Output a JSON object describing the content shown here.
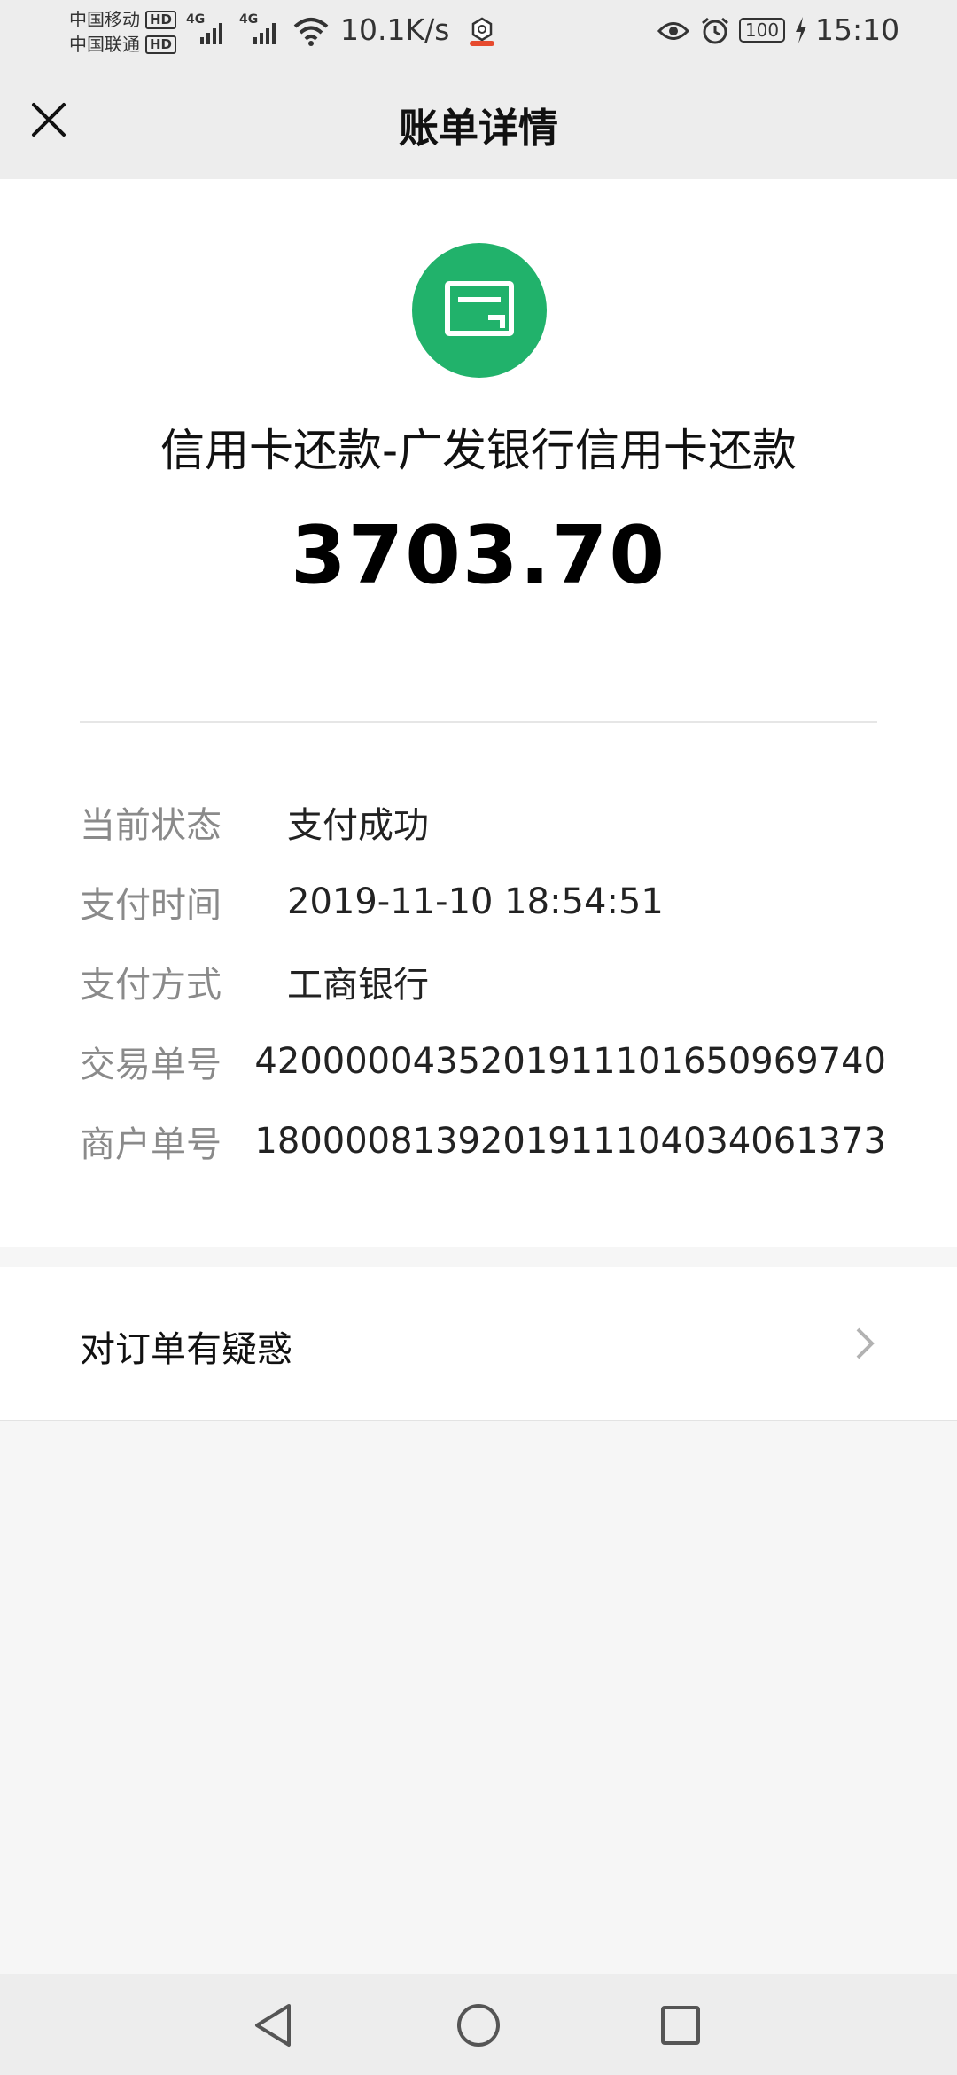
{
  "status_bar": {
    "carrier_1": "中国移动",
    "carrier_2": "中国联通",
    "hd_label": "HD",
    "network_type": "4G",
    "net_speed": "10.1K/s",
    "battery": "100",
    "time": "15:10",
    "icons": [
      "signal-icon",
      "wifi-icon",
      "app-notification-icon",
      "eye-icon",
      "alarm-icon",
      "battery-icon",
      "charging-icon"
    ]
  },
  "header": {
    "title": "账单详情",
    "close_icon": "close-icon"
  },
  "bill": {
    "merchant_icon": "card-icon",
    "merchant_name": "信用卡还款-广发银行信用卡还款",
    "amount": "3703.70",
    "details": [
      {
        "label": "当前状态",
        "value": "支付成功"
      },
      {
        "label": "支付时间",
        "value": "2019-11-10 18:54:51"
      },
      {
        "label": "支付方式",
        "value": "工商银行"
      },
      {
        "label": "交易单号",
        "value": "4200000435201911101650969740"
      },
      {
        "label": "商户单号",
        "value": "1800008139201911104034061373"
      }
    ]
  },
  "dispute": {
    "label": "对订单有疑惑",
    "icon": "chevron-right-icon"
  },
  "nav_bar": {
    "icons": [
      "back-icon",
      "home-icon",
      "recent-apps-icon"
    ]
  },
  "colors": {
    "accent_green": "#21b26b",
    "page_background": "#f6f6f6",
    "bar_background": "#ededed"
  }
}
